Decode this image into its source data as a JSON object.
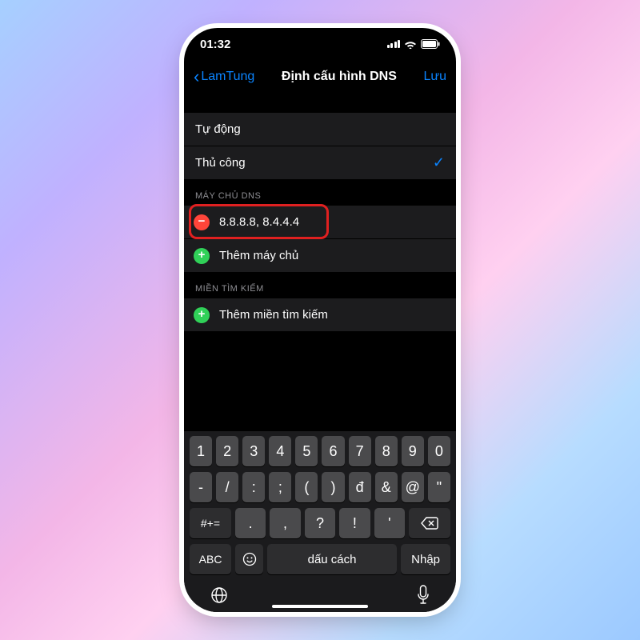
{
  "status": {
    "time": "01:32"
  },
  "nav": {
    "back": "LamTung",
    "title": "Định cấu hình DNS",
    "save": "Lưu"
  },
  "mode": {
    "auto": "Tự động",
    "manual": "Thủ công"
  },
  "dns": {
    "header": "MÁY CHỦ DNS",
    "entry": "8.8.8.8, 8.4.4.4",
    "add": "Thêm máy chủ"
  },
  "search": {
    "header": "MIỀN TÌM KIẾM",
    "add": "Thêm miền tìm kiếm"
  },
  "keyboard": {
    "row1": [
      "1",
      "2",
      "3",
      "4",
      "5",
      "6",
      "7",
      "8",
      "9",
      "0"
    ],
    "row2": [
      "-",
      "/",
      ":",
      ";",
      "(",
      ")",
      "đ",
      "&",
      "@",
      "\""
    ],
    "row3_label": "#+=",
    "row3": [
      ".",
      ",",
      "?",
      "!",
      "'"
    ],
    "abc": "ABC",
    "space": "dấu cách",
    "enter": "Nhập"
  }
}
